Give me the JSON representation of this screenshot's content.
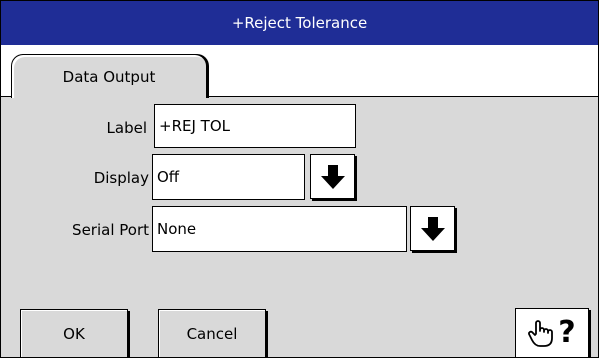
{
  "window": {
    "title": "+Reject Tolerance"
  },
  "tabs": [
    {
      "label": "Data Output",
      "selected": true
    }
  ],
  "form": {
    "label": {
      "caption": "Label",
      "value": "+REJ TOL"
    },
    "display": {
      "caption": "Display",
      "value": "Off",
      "button_icon": "arrow-down-icon"
    },
    "serial_port": {
      "caption": "Serial Port",
      "value": "None",
      "button_icon": "arrow-down-icon"
    }
  },
  "buttons": {
    "ok": "OK",
    "cancel": "Cancel",
    "help_icon": "help-hand-icon",
    "help_glyph": "?"
  },
  "colors": {
    "titlebar": "#1f2d96",
    "title_text": "#ffffff",
    "panel": "#d9d9d9"
  }
}
